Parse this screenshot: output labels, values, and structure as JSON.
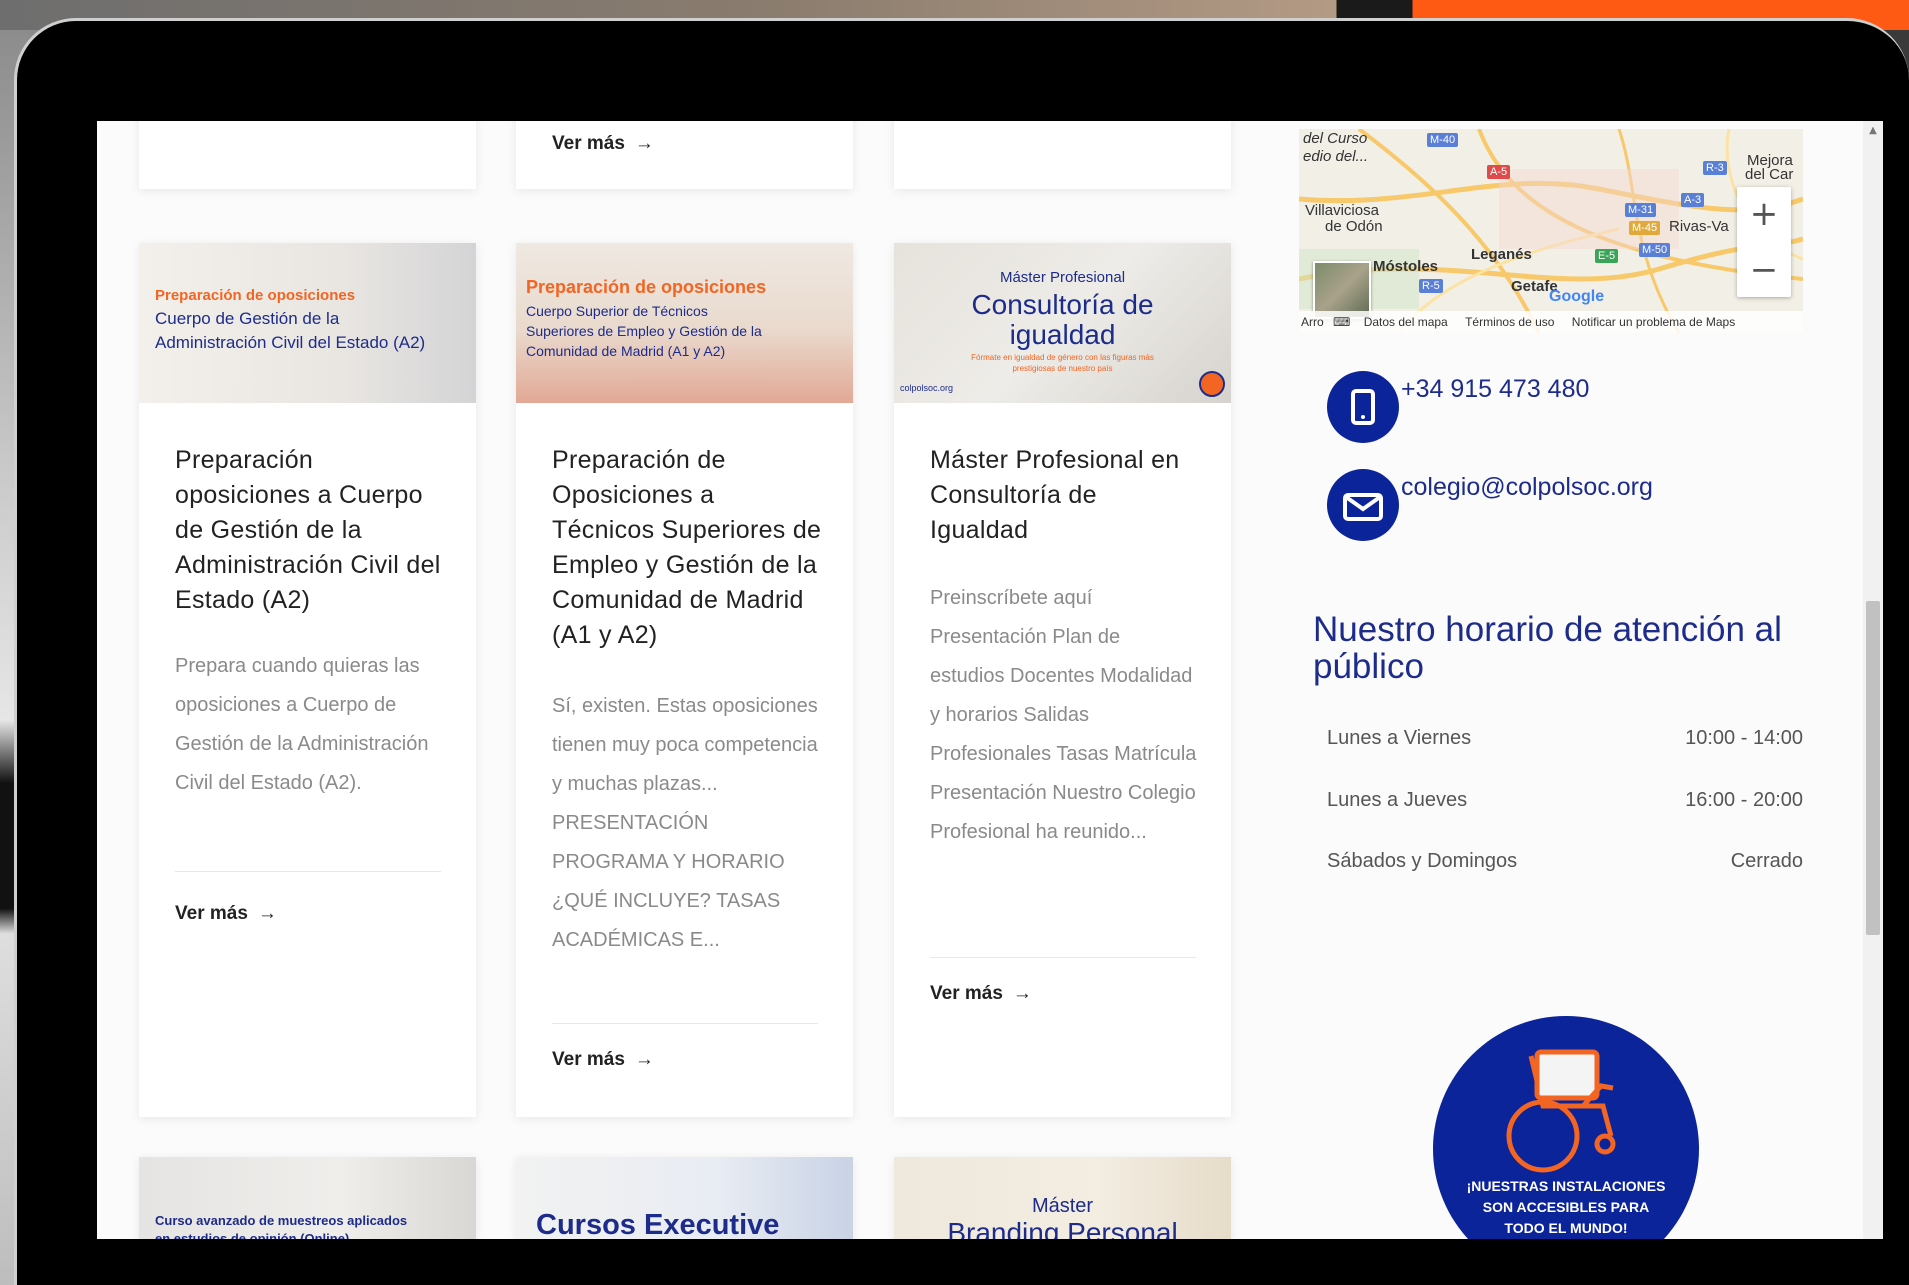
{
  "cards_top": {
    "vermas": "Ver más"
  },
  "cards": [
    {
      "image": {
        "lines_orange": [
          "Preparación de oposiciones"
        ],
        "lines_blue": [
          "Cuerpo de Gestión de la",
          "Administración Civil del Estado (A2)"
        ]
      },
      "title": "Preparación oposiciones a Cuerpo de Gestión de la Administración Civil del Estado (A2)",
      "excerpt": "Prepara cuando quieras las oposiciones a Cuerpo de Gestión de la Administración Civil del Estado (A2).",
      "vermas": "Ver más"
    },
    {
      "image": {
        "lines_orange": [
          "Preparación de oposiciones"
        ],
        "lines_blue": [
          "Cuerpo Superior de Técnicos",
          "Superiores de Empleo y Gestión de la",
          "Comunidad de Madrid (A1 y A2)"
        ]
      },
      "title": "Preparación de Oposiciones a Técnicos Superiores de Empleo y Gestión de la Comunidad de Madrid (A1 y A2)",
      "excerpt": "Sí, existen. Estas oposiciones tienen muy poca competencia y muchas plazas... PRESENTACIÓN PROGRAMA Y HORARIO ¿QUÉ INCLUYE? TASAS ACADÉMICAS E...",
      "vermas": "Ver más"
    },
    {
      "image": {
        "line_small": "Máster Profesional",
        "line_big1": "Consultoría de",
        "line_big2": "igualdad",
        "line_tiny1": "Fórmate en igualdad de género con las figuras más",
        "line_tiny2": "prestigiosas de nuestro país",
        "logo": "colpolsoc.org"
      },
      "title": "Máster Profesional en Consultoría de Igualdad",
      "excerpt": "Preinscríbete aquí Presentación Plan de estudios Docentes Modalidad y horarios Salidas Profesionales Tasas Matrícula Presentación Nuestro Colegio Profesional ha reunido...",
      "vermas": "Ver más"
    }
  ],
  "cards_bottom": [
    {
      "text": "Curso avanzado de muestreos aplicados",
      "text2": "en estudios de opinión (Online)"
    },
    {
      "text": "Cursos Executive"
    },
    {
      "text": "Máster",
      "text2": "Branding Personal"
    }
  ],
  "map": {
    "labels": {
      "curso": "del Curso",
      "edio": "edio del...",
      "villaviciosa": "Villaviciosa",
      "de_odon": "de Odón",
      "mostoles": "Móstoles",
      "leganes": "Leganés",
      "getafe": "Getafe",
      "rivas": "Rivas-Va",
      "mejora": "Mejora",
      "del_car": "del Car",
      "arro": "Arro",
      "google": "Google"
    },
    "roads": [
      "M-40",
      "A-5",
      "R-3",
      "A-3",
      "M-31",
      "M-45",
      "E-5",
      "M-50",
      "R-5"
    ],
    "zoom_in": "+",
    "zoom_out": "−",
    "footer": {
      "datos": "Datos del mapa",
      "terminos": "Términos de uso",
      "notificar": "Notificar un problema de Maps"
    }
  },
  "contact": {
    "phone": "+34 915 473 480",
    "email": "colegio@colpolsoc.org"
  },
  "schedule": {
    "title": "Nuestro horario de atención al público",
    "rows": [
      {
        "day": "Lunes a Viernes",
        "time": "10:00 - 14:00"
      },
      {
        "day": "Lunes a Jueves",
        "time": "16:00 - 20:00"
      },
      {
        "day": "Sábados y Domingos",
        "time": "Cerrado"
      }
    ]
  },
  "accessibility": {
    "line1": "¡NUESTRAS INSTALACIONES",
    "line2": "SON ACCESIBLES PARA",
    "line3": "TODO EL MUNDO!"
  },
  "colors": {
    "brand_blue": "#1d2c8a",
    "accent_orange": "#f26522",
    "badge_blue": "#0c2499"
  }
}
